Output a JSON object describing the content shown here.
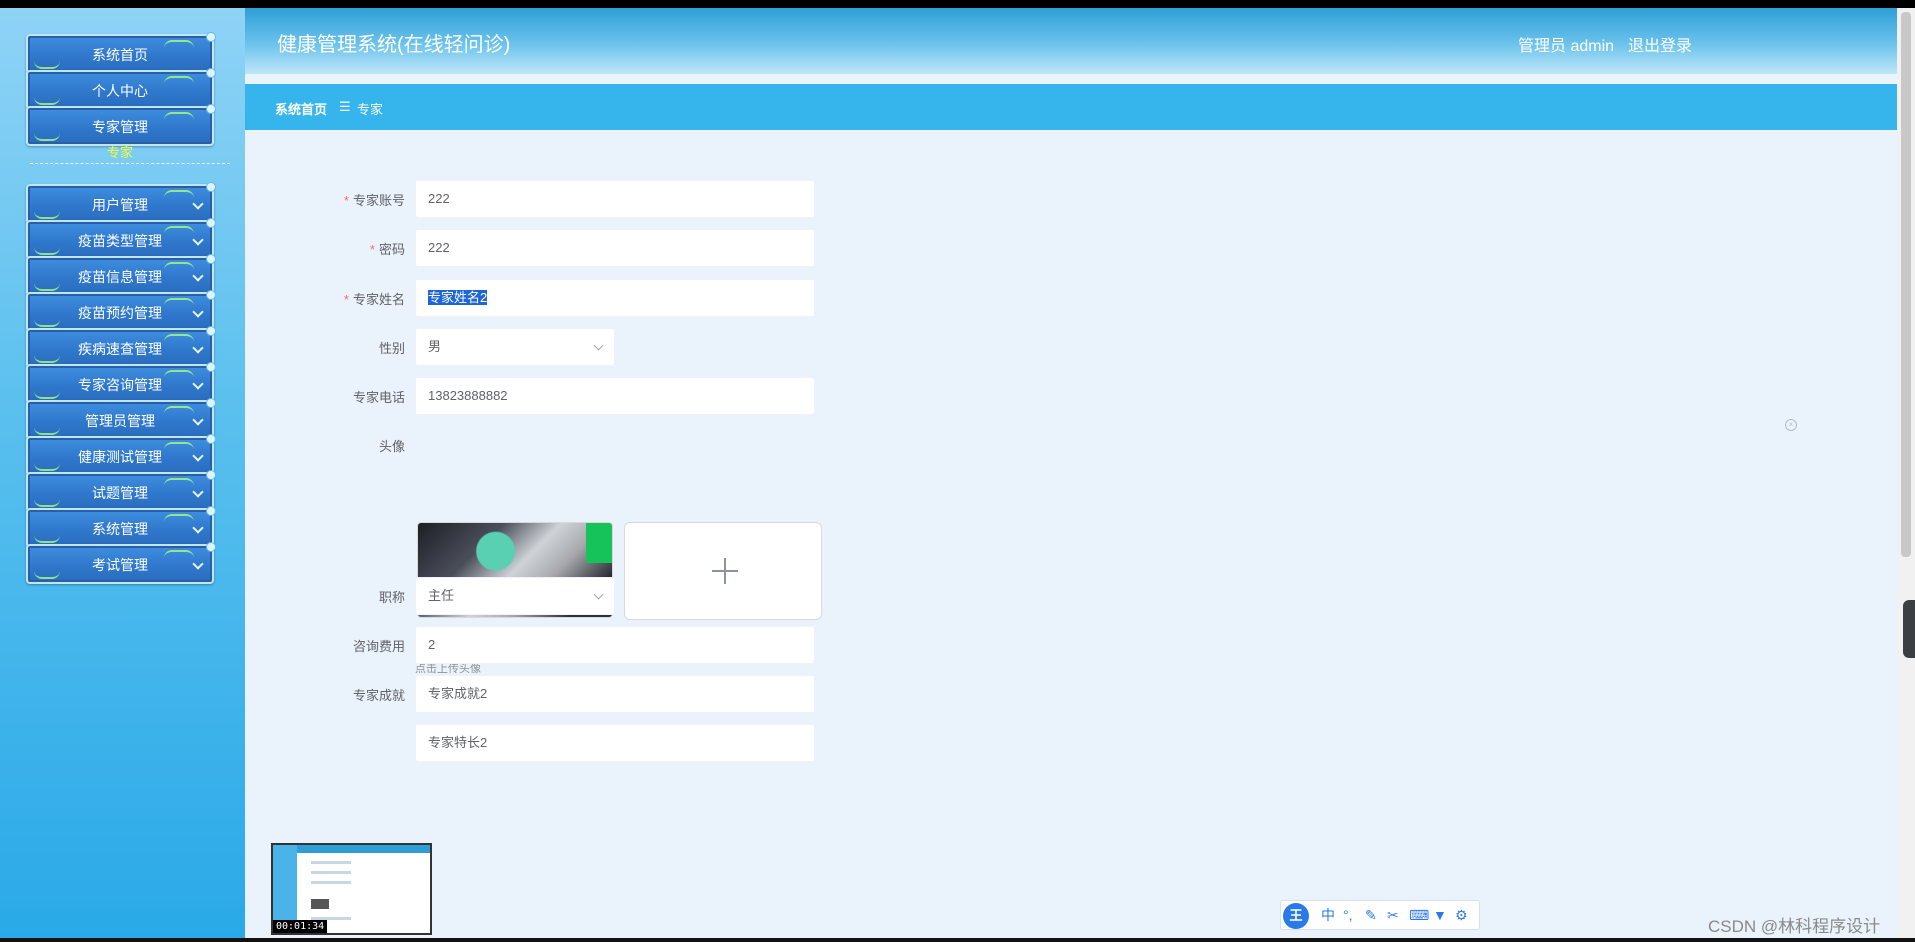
{
  "app": {
    "title": "健康管理系统(在线轻问诊)"
  },
  "header": {
    "user": "管理员 admin",
    "logout": "退出登录"
  },
  "sidebar": {
    "items": [
      {
        "label": "系统首页"
      },
      {
        "label": "个人中心"
      },
      {
        "label": "专家管理"
      },
      {
        "label": "用户管理"
      },
      {
        "label": "疫苗类型管理"
      },
      {
        "label": "疫苗信息管理"
      },
      {
        "label": "疫苗预约管理"
      },
      {
        "label": "疾病速查管理"
      },
      {
        "label": "专家咨询管理"
      },
      {
        "label": "管理员管理"
      },
      {
        "label": "健康测试管理"
      },
      {
        "label": "试题管理"
      },
      {
        "label": "系统管理"
      },
      {
        "label": "考试管理"
      }
    ],
    "sub_item": "专家"
  },
  "breadcrumb": {
    "home": "系统首页",
    "separator": "☰",
    "current": "专家"
  },
  "form": {
    "account": {
      "label": "专家账号",
      "value": "222"
    },
    "password": {
      "label": "密码",
      "value": "222"
    },
    "name": {
      "label": "专家姓名",
      "value": "专家姓名2"
    },
    "gender": {
      "label": "性别",
      "value": "男"
    },
    "phone": {
      "label": "专家电话",
      "value": "13823888882"
    },
    "avatar": {
      "label": "头像",
      "tip": "点击上传头像"
    },
    "title": {
      "label": "职称",
      "value": "主任"
    },
    "fee": {
      "label": "咨询费用",
      "value": "2"
    },
    "achievement": {
      "label": "专家成就",
      "value": "专家成就2"
    },
    "specialty": {
      "value": "专家特长2"
    }
  },
  "overlay": {
    "video_time": "00:01:34",
    "ime_logo": "王",
    "ime_mode": "中",
    "watermark": "CSDN @林科程序设计"
  },
  "colors": {
    "sidebar": "#58bfee",
    "header": "#2d9fd6",
    "breadcrumb": "#36b4ec",
    "main_bg": "#eaf2fb",
    "required": "#f56c6c",
    "sub_item": "#f2ff3a"
  }
}
